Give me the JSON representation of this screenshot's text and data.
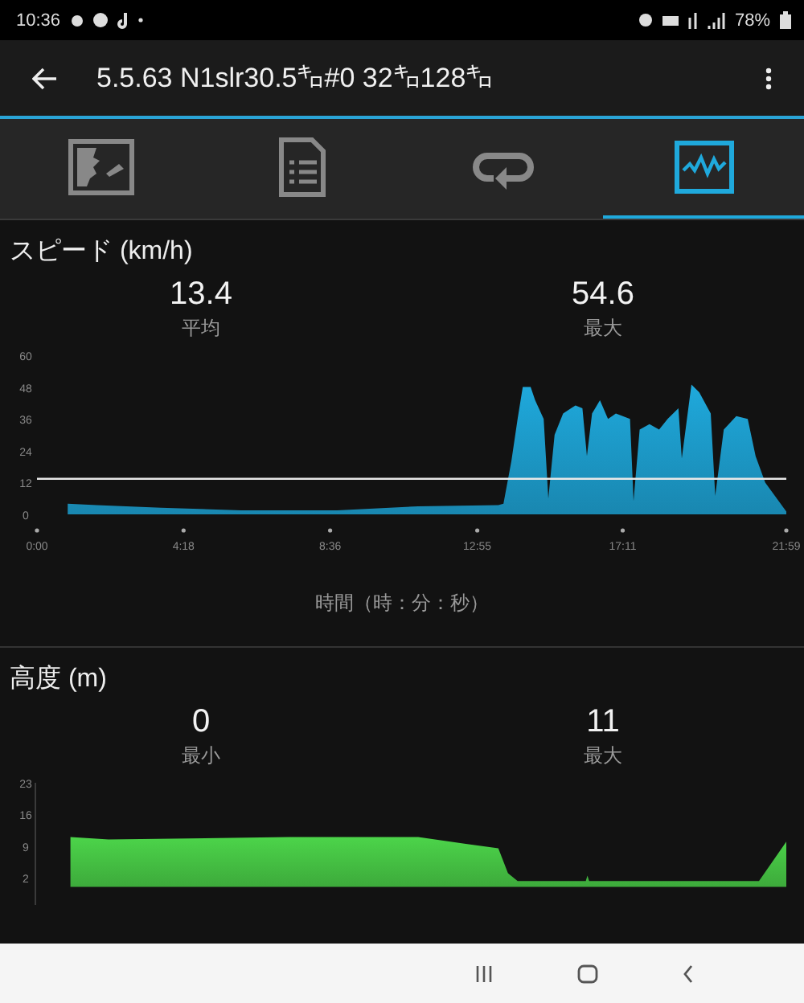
{
  "status_bar": {
    "time": "10:36",
    "battery": "78%"
  },
  "app_bar": {
    "title": "5.5.63 N1slr30.5㌔#0 32㌔128㌔"
  },
  "tabs": [
    {
      "selected": false
    },
    {
      "selected": false
    },
    {
      "selected": false
    },
    {
      "selected": true
    }
  ],
  "sections": [
    {
      "title": "スピード (km/h)",
      "stats": [
        {
          "value": "13.4",
          "label": "平均"
        },
        {
          "value": "54.6",
          "label": "最大"
        }
      ],
      "chart_data": {
        "type": "area",
        "xlabel": "時間（時：分：秒）",
        "xlim": [
          0,
          1319
        ],
        "ylim": [
          0,
          60
        ],
        "yticks": [
          0,
          12,
          24,
          36,
          48,
          60
        ],
        "xticks": [
          {
            "value": 0,
            "label": "0:00"
          },
          {
            "value": 258,
            "label": "4:18"
          },
          {
            "value": 516,
            "label": "8:36"
          },
          {
            "value": 775,
            "label": "12:55"
          },
          {
            "value": 1031,
            "label": "17:11"
          },
          {
            "value": 1319,
            "label": "21:59"
          }
        ],
        "x": [
          54,
          105,
          218,
          359,
          529,
          671,
          812,
          821,
          835,
          846,
          855,
          869,
          877,
          892,
          900,
          911,
          926,
          940,
          948,
          960,
          968,
          977,
          991,
          1005,
          1019,
          1044,
          1050,
          1061,
          1078,
          1095,
          1110,
          1129,
          1135,
          1152,
          1166,
          1186,
          1194,
          1209,
          1231,
          1251,
          1265,
          1282,
          1319
        ],
        "series": [
          {
            "color": "#1fa9dc",
            "values": [
              4,
              3.5,
              2.5,
              1.5,
              1.5,
              3,
              3.5,
              4,
              20,
              36,
              48,
              48,
              43,
              36,
              6,
              30,
              38,
              40,
              41,
              40,
              22,
              38,
              43,
              36,
              38,
              36,
              5,
              32,
              34,
              32,
              36,
              40,
              21,
              49,
              46,
              38,
              7,
              32,
              37,
              36,
              22,
              12,
              1
            ]
          }
        ],
        "ref_lines": [
          {
            "axis": "y",
            "value": 13.4
          }
        ]
      }
    },
    {
      "title": "高度 (m)",
      "stats": [
        {
          "value": "0",
          "label": "最小"
        },
        {
          "value": "11",
          "label": "最大"
        }
      ],
      "chart_data": {
        "type": "area",
        "xlim": [
          0,
          1319
        ],
        "ylim": [
          -4,
          23
        ],
        "yticks": [
          2,
          9,
          16,
          23
        ],
        "x": [
          59,
          126,
          444,
          671,
          755,
          812,
          829,
          846,
          966,
          969,
          972,
          1271,
          1319
        ],
        "series": [
          {
            "color": "#4cd44a",
            "values": [
              11,
              10.5,
              11,
              11,
              9.5,
              8.5,
              3,
              1.3,
              1.3,
              2.5,
              1.3,
              1.3,
              10
            ]
          }
        ]
      }
    }
  ]
}
